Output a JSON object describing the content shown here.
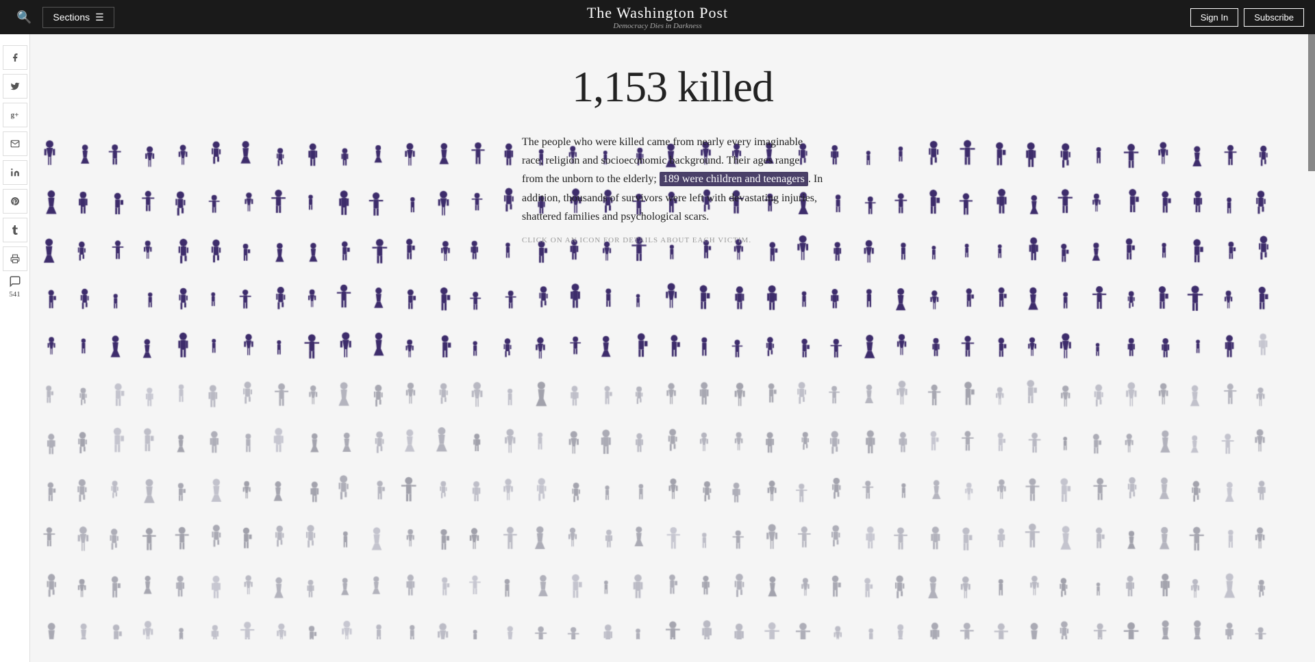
{
  "navbar": {
    "search_icon": "🔍",
    "sections_label": "Sections",
    "hamburger": "☰",
    "site_title": "The Washington Post",
    "site_tagline": "Democracy Dies in Darkness",
    "sign_in_label": "Sign In",
    "subscribe_label": "Subscribe"
  },
  "sidebar": {
    "icons": [
      {
        "name": "facebook-icon",
        "symbol": "f",
        "interactable": true
      },
      {
        "name": "twitter-icon",
        "symbol": "t",
        "interactable": true
      },
      {
        "name": "google-plus-icon",
        "symbol": "g+",
        "interactable": true
      },
      {
        "name": "email-icon",
        "symbol": "✉",
        "interactable": true
      },
      {
        "name": "linkedin-icon",
        "symbol": "in",
        "interactable": true
      },
      {
        "name": "pinterest-icon",
        "symbol": "p",
        "interactable": true
      },
      {
        "name": "tumblr-icon",
        "symbol": "t",
        "interactable": true
      },
      {
        "name": "print-icon",
        "symbol": "🖨",
        "interactable": true
      }
    ],
    "comment_icon": "💬",
    "comment_count": "541"
  },
  "article": {
    "headline": "1,153 killed",
    "body_text_1": "The people who were killed came from nearly every imaginable race, religion and socioeconomic background. Their ages range from the unborn to the elderly; ",
    "highlight_text": "189 were children and teenagers",
    "body_text_2": ". In addition, thousands of survivors were left with devastating injuries, shattered families and psychological scars.",
    "click_instruction": "CLICK ON AN ICON FOR DETAILS ABOUT EACH VICTIM.",
    "total_victims": 1153,
    "highlighted_victims": 189
  }
}
